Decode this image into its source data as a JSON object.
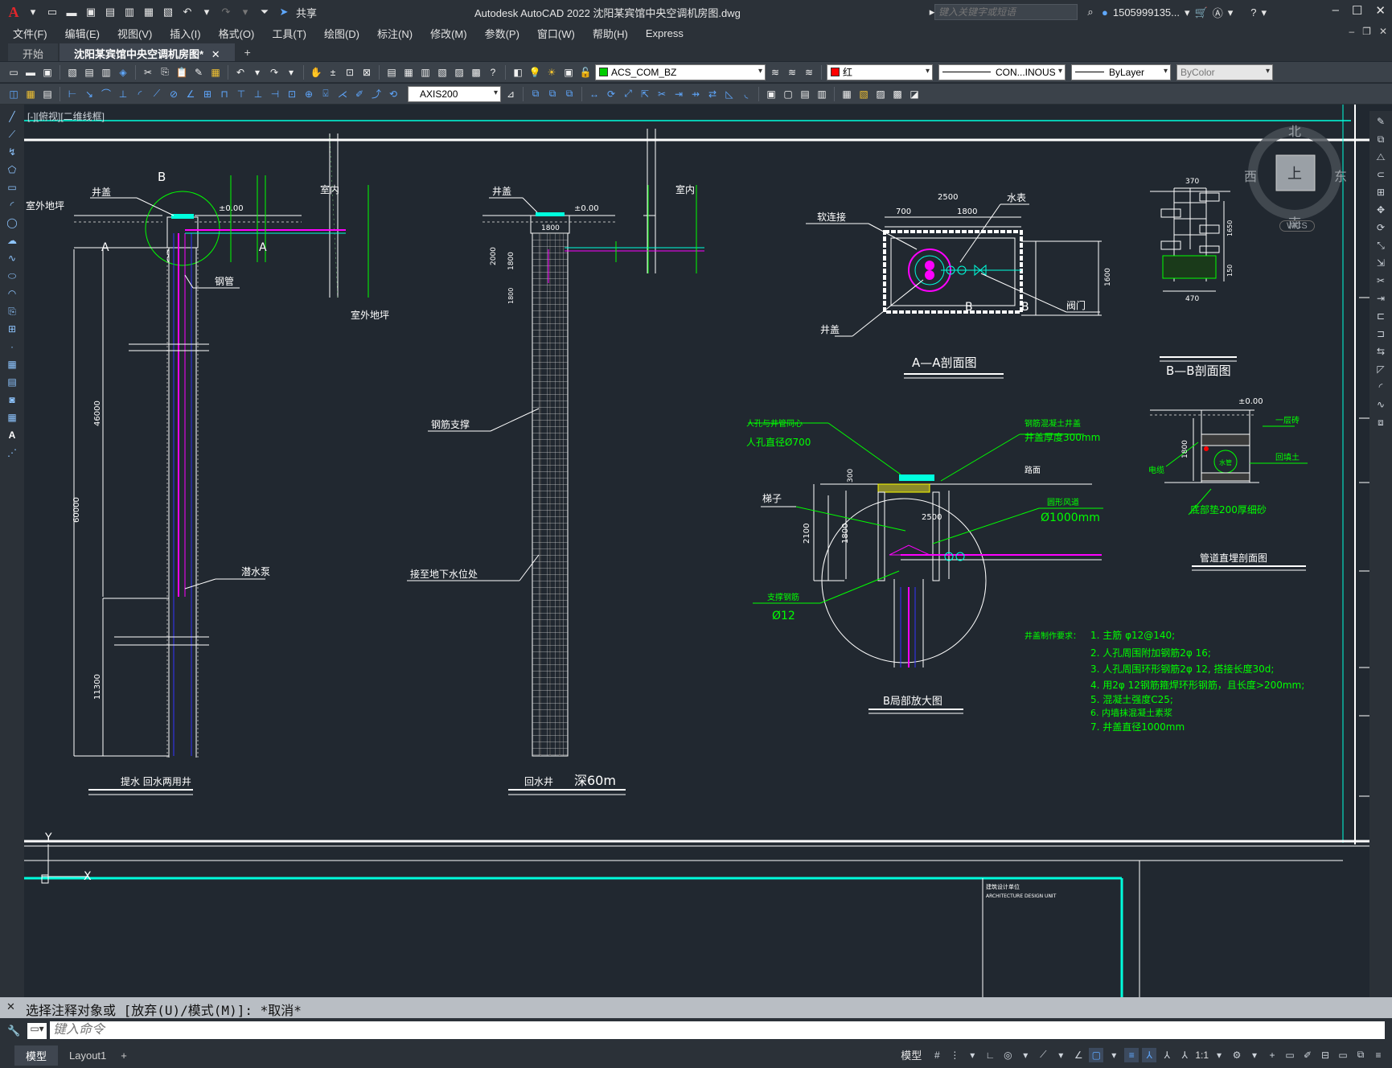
{
  "titlebar": {
    "app_title": "Autodesk AutoCAD 2022    沈阳某宾馆中央空调机房图.dwg",
    "share_label": "共享",
    "search_placeholder": "键入关键字或短语",
    "user": "1505999135...",
    "logo": "A"
  },
  "menu": [
    "文件(F)",
    "编辑(E)",
    "视图(V)",
    "插入(I)",
    "格式(O)",
    "工具(T)",
    "绘图(D)",
    "标注(N)",
    "修改(M)",
    "参数(P)",
    "窗口(W)",
    "帮助(H)",
    "Express"
  ],
  "file_tabs": [
    {
      "label": "开始",
      "active": false
    },
    {
      "label": "沈阳某宾馆中央空调机房图*",
      "active": true
    }
  ],
  "properties": {
    "layer": "ACS_COM_BZ",
    "color": "红",
    "linetype": "CON...INOUS",
    "lineweight": "ByLayer",
    "plotstyle": "ByColor",
    "dimstyle": "AXIS200"
  },
  "colors": {
    "layer_swatch": "#00cc00",
    "red_swatch": "#ff0000",
    "canvas_bg": "#212830",
    "accent_blue": "#5fa8ff"
  },
  "viewport_label": "[-][俯视][二维线框]",
  "viewcube": {
    "north": "北",
    "south": "南",
    "east": "东",
    "west": "西",
    "top": "上",
    "ucs": "WCS"
  },
  "drawing": {
    "well1": {
      "label_B": "B",
      "well_cover": "井盖",
      "outdoor_ground": "室外地坪",
      "indoor": "室内",
      "elev": "±0.00",
      "section_A": "A",
      "steel_pipe": "钢管",
      "outdoor_ground2": "室外地坪",
      "dim_46000": "46000",
      "dim_60000": "60000",
      "dim_11300": "11300",
      "pump": "潜水泵",
      "title": "提水  回水两用井"
    },
    "well2": {
      "well_cover": "井盖",
      "elev": "±0.00",
      "indoor": "室内",
      "dim_1800": "1800",
      "dim_2000": "2000",
      "dim_1800v": "1800",
      "dim_1800b": "1800",
      "steel_support": "钢筋支撑",
      "to_groundwater": "接至地下水位处",
      "title": "回水井",
      "depth": "深60m"
    },
    "sectionAA": {
      "soft_joint": "软连接",
      "water_meter": "水表",
      "dim_2500": "2500",
      "dim_700": "700",
      "dim_1800": "1800",
      "dim_1600": "1600",
      "well_cover": "井盖",
      "valve": "阀门",
      "label_B1": "B",
      "label_B2": "B",
      "title": "A—A剖面图"
    },
    "sectionBB": {
      "dim_370": "370",
      "dim_1650": "1650",
      "dim_150": "150",
      "dim_470": "470",
      "title": "B—B剖面图"
    },
    "detailB": {
      "manhole_note1": "人孔与井管同心",
      "manhole_note2": "人孔直径Ø700",
      "concrete_cover": "钢筋混凝土井盖",
      "cover_thk": "井盖厚度300mm",
      "road": "路面",
      "ladder": "梯子",
      "dim_300": "300",
      "dim_2500": "2500",
      "dim_2100": "2100",
      "dim_1800": "1800",
      "vent_pipe": "圆形风道",
      "vent_dia": "Ø1000mm",
      "support_rebar": "支撑钢筋",
      "rebar_dia": "Ø12",
      "title": "B局部放大图"
    },
    "notes": {
      "heading": "井盖制作要求：",
      "items": [
        "1. 主筋 φ12@140;",
        "2. 人孔周围附加钢筋2φ 16;",
        "3. 人孔周围环形钢筋2φ 12, 搭接长度30d;",
        "4. 用2φ 12钢筋箍焊环形钢筋，且长度>200mm;",
        "5. 混凝土强度C25;",
        "6. 内墙抹混凝土素浆",
        "7. 井盖直径1000mm"
      ]
    },
    "pipeTrench": {
      "elev": "±0.00",
      "floor1": "一层砖",
      "dim_1800": "1800",
      "cable": "电缆",
      "backfill": "回填土",
      "pipe": "水管",
      "sand": "底部垫200厚细砂",
      "title": "管道直埋剖面图"
    },
    "titleblock": {
      "unit_cn": "建筑设计单位",
      "unit_en": "ARCHITECTURE DESIGN UNIT"
    },
    "ucs_y": "Y",
    "ucs_x": "X"
  },
  "command": {
    "history": "选择注释对象或 [放弃(U)/模式(M)]: *取消*",
    "placeholder": "键入命令"
  },
  "layout_tabs": [
    {
      "label": "模型",
      "active": true
    },
    {
      "label": "Layout1",
      "active": false
    }
  ],
  "status": {
    "model": "模型",
    "scale": "1:1"
  }
}
